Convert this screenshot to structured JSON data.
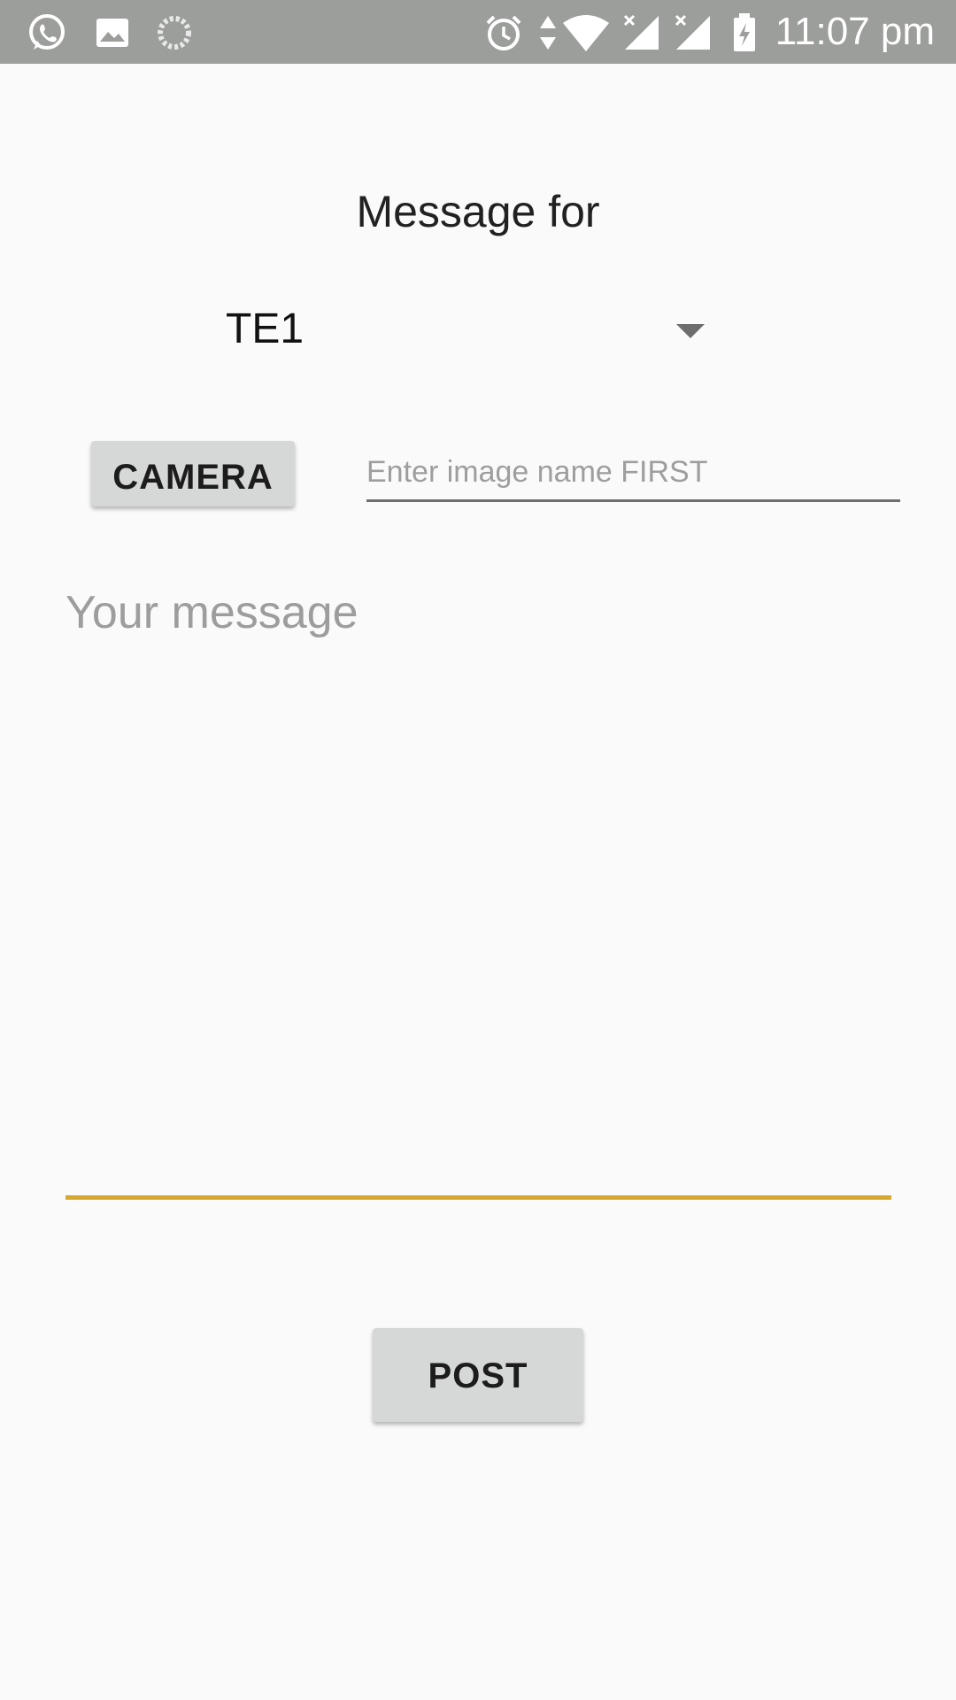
{
  "status_bar": {
    "time": "11:07 pm",
    "left_icons": [
      "whatsapp-icon",
      "gallery-icon",
      "loading-icon"
    ],
    "right_icons": [
      "alarm-icon",
      "data-transfer-icon",
      "wifi-icon",
      "signal-no-service-icon",
      "signal-no-service-icon",
      "battery-charging-icon"
    ],
    "background": "#9c9e9b"
  },
  "form": {
    "title": "Message for",
    "recipient_selected": "TE1",
    "camera_label": "CAMERA",
    "image_name_placeholder": "Enter image name FIRST",
    "message_placeholder": "Your message",
    "post_label": "POST",
    "accent_color": "#d6a92e"
  }
}
